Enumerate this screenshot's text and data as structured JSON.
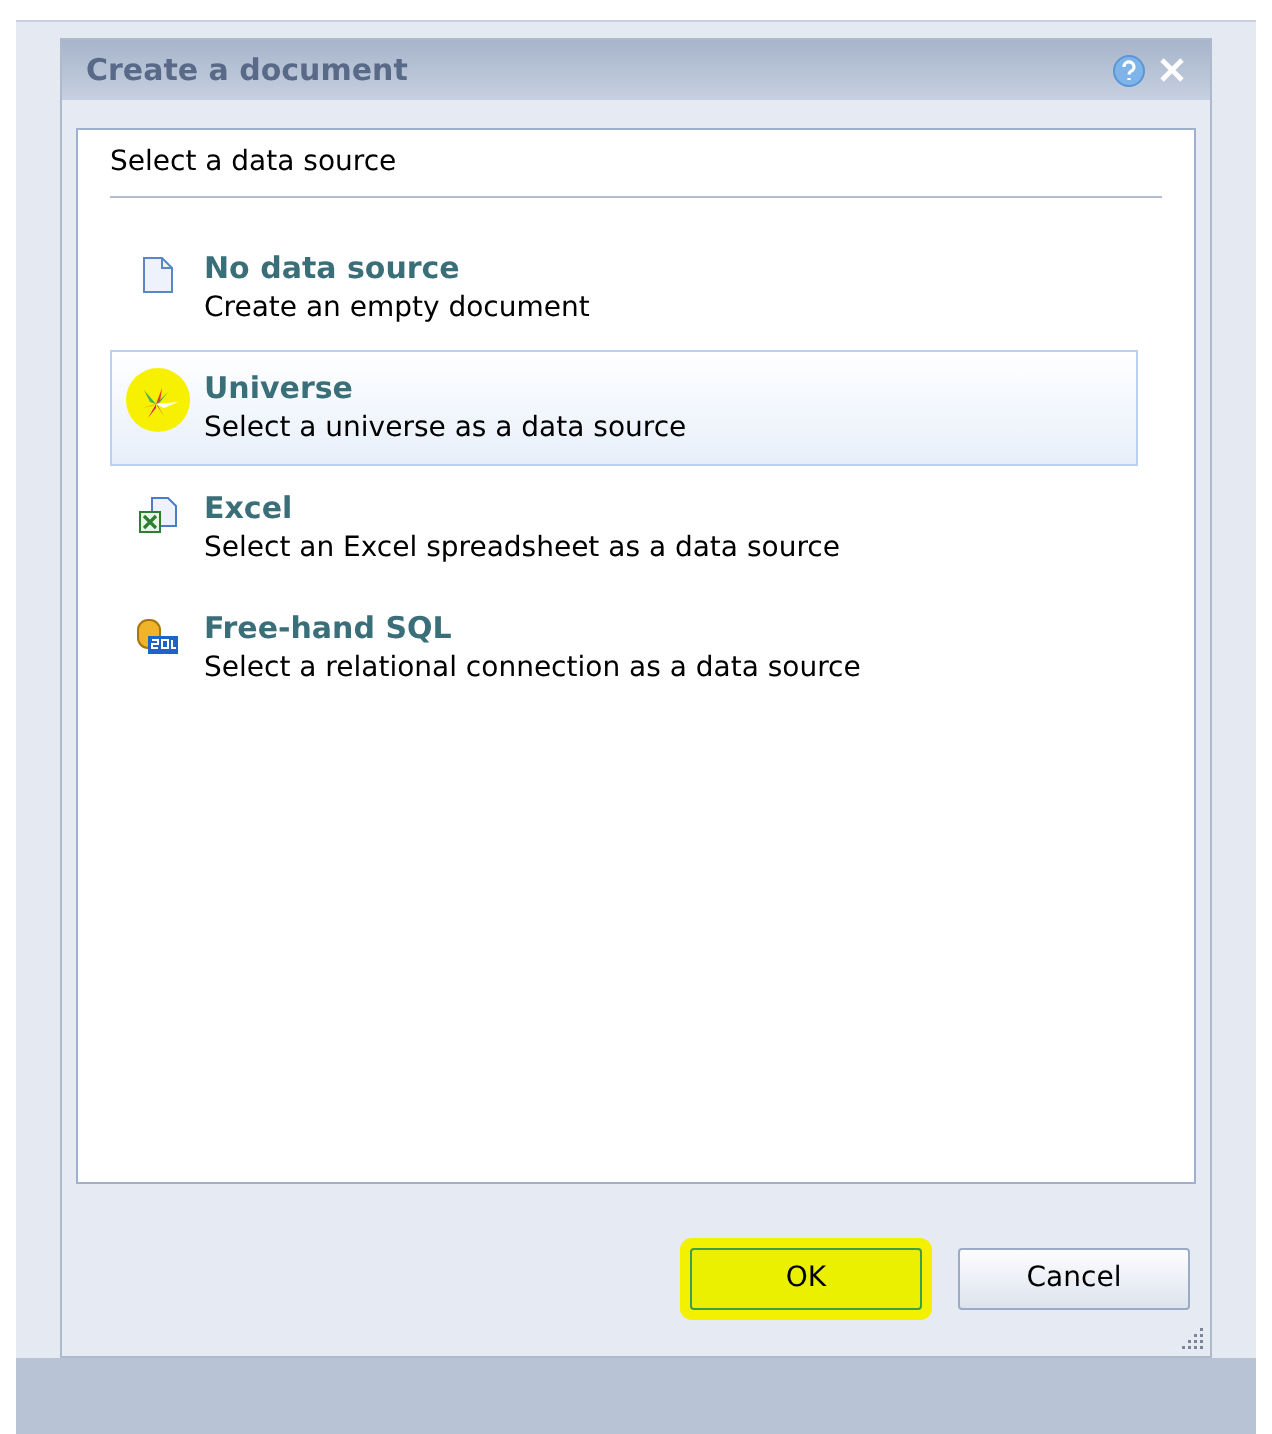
{
  "window": {
    "title": "Create a document"
  },
  "section_title": "Select a data source",
  "sources": [
    {
      "kind": "blank",
      "title": "No data source",
      "description": "Create an empty document",
      "selected": false
    },
    {
      "kind": "universe",
      "title": "Universe",
      "description": "Select a universe as a data source",
      "selected": true
    },
    {
      "kind": "excel",
      "title": "Excel",
      "description": "Select an Excel spreadsheet as a data source",
      "selected": false
    },
    {
      "kind": "sql",
      "title": "Free-hand SQL",
      "description": "Select a relational connection as a data source",
      "selected": false
    }
  ],
  "buttons": [
    {
      "label": "OK",
      "highlighted": true
    },
    {
      "label": "Cancel",
      "highlighted": false
    }
  ]
}
